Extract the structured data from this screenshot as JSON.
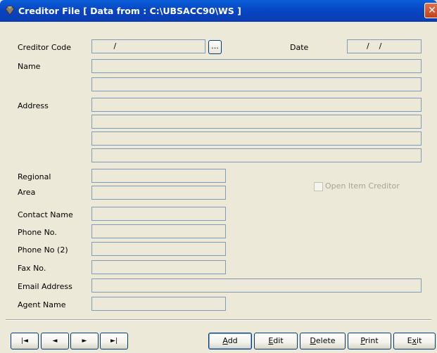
{
  "window": {
    "title": "Creditor File [ Data from : C:\\UBSACC90\\WS ]",
    "close_glyph": "✕",
    "title_icon": "gem-icon",
    "colors": {
      "titlebar": "#0846c4",
      "background": "#ece9d8",
      "close": "#c4401c"
    }
  },
  "form": {
    "creditor_code_label": "Creditor Code",
    "creditor_code_value": "       /",
    "lookup_button": "...",
    "date_label": "Date",
    "date_value": "      /    /",
    "name_label": "Name",
    "address_label": "Address",
    "regional_label": "Regional",
    "area_label": "Area",
    "open_item_label": "Open Item Creditor",
    "contact_name_label": "Contact Name",
    "phone_label": "Phone No.",
    "phone2_label": "Phone No (2)",
    "fax_label": "Fax No.",
    "email_label": "Email Address",
    "agent_label": "Agent Name"
  },
  "nav": {
    "first": "|◄",
    "prev": "◄",
    "next": "►",
    "last": "►|"
  },
  "actions": {
    "add_hot": "A",
    "add_rest": "dd",
    "edit_hot": "E",
    "edit_rest": "dit",
    "delete_hot": "D",
    "delete_rest": "elete",
    "print_hot": "P",
    "print_rest": "rint",
    "exit_pre": "E",
    "exit_hot": "x",
    "exit_rest": "it"
  }
}
